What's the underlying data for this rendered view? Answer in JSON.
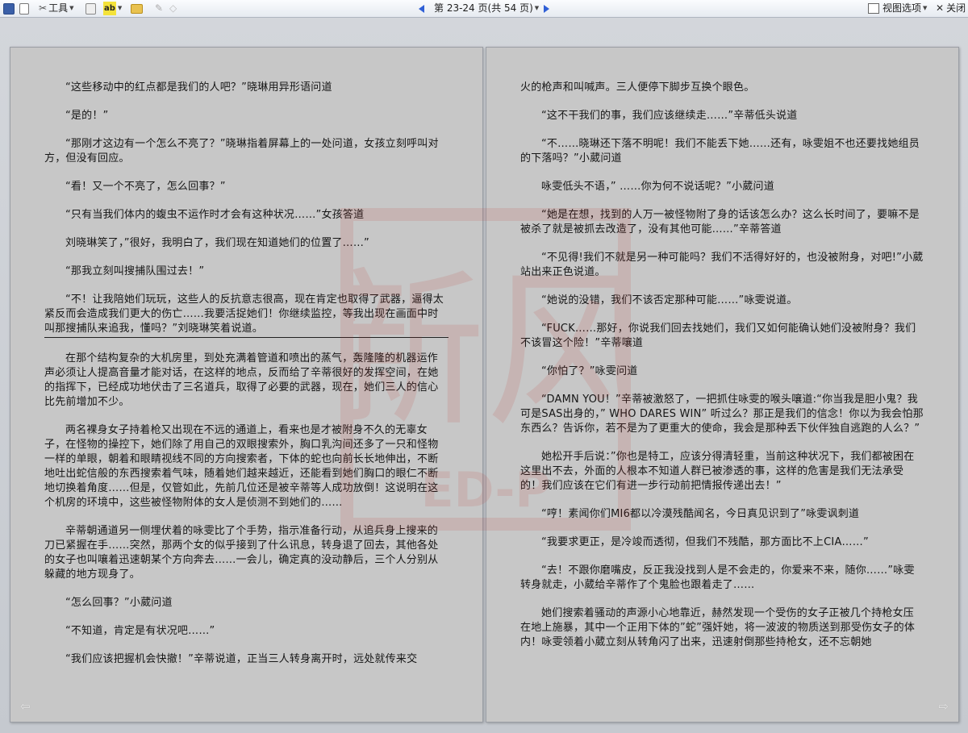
{
  "toolbar": {
    "tools_label": "工具",
    "page_indicator": "第 23-24 页(共 54 页)",
    "view_options_label": "视图选项",
    "close_label": "关闭"
  },
  "watermark": {
    "text_cn": "新风",
    "text_en": "ED-P"
  },
  "left_page": {
    "paragraphs": [
      "“这些移动中的红点都是我们的人吧？”晓琳用异形语问道",
      "“是的！”",
      "“那刚才这边有一个怎么不亮了？”晓琳指着屏幕上的一处问道，女孩立刻呼叫对方，但没有回应。",
      "“看！又一个不亮了，怎么回事？”",
      "“只有当我们体内的蝮虫不运作时才会有这种状况……”女孩答道",
      "刘晓琳笑了，”很好，我明白了，我们现在知道她们的位置了……”",
      "“那我立刻叫搜捕队围过去！”",
      "“不！让我陪她们玩玩，这些人的反抗意志很高，现在肯定也取得了武器，逼得太紧反而会造成我们更大的伤亡……我要活捉她们！你继续监控，等我出现在画面中时叫那搜捕队来追我，懂吗？”刘晓琳笑着说道。",
      "在那个结构复杂的大机房里，到处充满着管道和喷出的蒸气，轰隆隆的机器运作声必须让人提高音量才能对话，在这样的地点，反而给了辛蒂很好的发挥空间，在她的指挥下，已经成功地伏击了三名道兵，取得了必要的武器，现在，她们三人的信心比先前增加不少。",
      "两名裸身女子持着枪又出现在不远的通道上，看来也是才被附身不久的无辜女子，在怪物的操控下，她们除了用自己的双眼搜索外，胸口乳沟间还多了一只和怪物一样的单眼，朝着和眼睛视线不同的方向搜索者，下体的蛇也向前长长地伸出，不断地吐出蛇信般的东西搜索着气味，随着她们越来越近，还能看到她们胸口的眼仁不断地切换着角度……但是，仅管如此，先前几位还是被辛蒂等人成功放倒！这说明在这个机房的环境中，这些被怪物附体的女人是侦测不到她们的……",
      "辛蒂朝通道另一侧埋伏着的咏雯比了个手势，指示准备行动，从追兵身上搜来的刀已紧握在手……突然，那两个女的似乎接到了什么讯息，转身退了回去，其他各处的女子也叫嚷着迅速朝某个方向奔去……一会儿，确定真的没动静后，三个人分别从躲藏的地方现身了。",
      "“怎么回事？”小葳问道",
      "“不知道，肯定是有状况吧……”",
      "“我们应该把握机会快撤！”辛蒂说道，正当三人转身离开时，远处就传来交"
    ]
  },
  "right_page": {
    "paragraphs": [
      "火的枪声和叫喊声。三人便停下脚步互换个眼色。",
      "“这不干我们的事，我们应该继续走……”辛蒂低头说道",
      "“不……晓琳还下落不明呢！我们不能丢下她……还有，咏雯姐不也还要找她组员的下落吗？”小葳问道",
      "咏雯低头不语，” ……你为何不说话呢？”小葳问道",
      "“她是在想，找到的人万一被怪物附了身的话该怎么办？这么长时间了，要嘛不是被杀了就是被抓去改造了，没有其他可能……”辛蒂答道",
      "“不见得!我们不就是另一种可能吗？我们不活得好好的，也没被附身，对吧!”小葳站出来正色说道。",
      "“她说的没错，我们不该否定那种可能……”咏雯说道。",
      "“FUCK……那好，你说我们回去找她们，我们又如何能确认她们没被附身？我们不该冒这个险！”辛蒂嚷道",
      "“你怕了？”咏雯问道",
      "“DAMN YOU！”辛蒂被激怒了，一把抓住咏雯的喉头嚷道:“你当我是胆小鬼？我可是SAS出身的，” WHO DARES WIN” 听过么？那正是我们的信念！你以为我会怕那东西么？告诉你，若不是为了更重大的使命，我会是那种丢下伙伴独自逃跑的人么？”",
      "她松开手后说：”你也是特工，应该分得清轻重，当前这种状况下，我们都被困在这里出不去，外面的人根本不知道人群已被渗透的事，这样的危害是我们无法承受的！我们应该在它们有进一步行动前把情报传递出去！”",
      "“哼！素闻你们MI6都以冷漠残酷闻名，今日真见识到了”咏雯讽刺道",
      "“我要求更正，是冷竣而透彻，但我们不残酷，那方面比不上CIA……”",
      "“去！不跟你磨嘴皮，反正我没找到人是不会走的，你爱来不来，随你……”咏雯转身就走，小葳给辛蒂作了个鬼脸也跟着走了……",
      "她们搜索着骚动的声源小心地靠近，赫然发现一个受伤的女子正被几个持枪女压在地上施暴，其中一个正用下体的”蛇”强奸她，将一波波的物质送到那受伤女子的体内！咏雯领着小葳立刻从转角闪了出来，迅速射倒那些持枪女，还不忘朝她"
    ]
  },
  "colors": {
    "page_bg": "#c7c7c7",
    "workspace_bg": "#cdd0d5",
    "nav_blue": "#2f5fd6",
    "watermark_red": "#c0302a"
  }
}
